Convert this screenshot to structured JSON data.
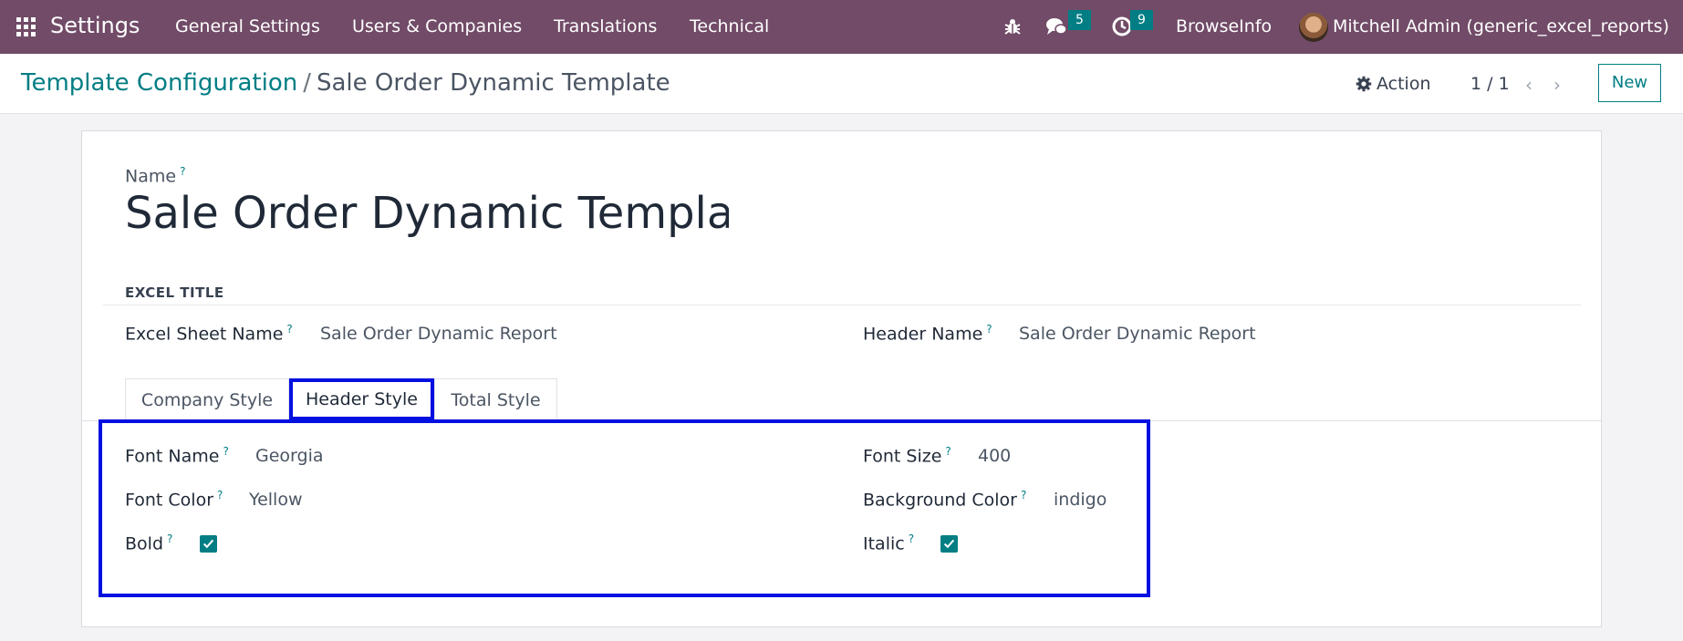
{
  "navbar": {
    "brand": "Settings",
    "menu": [
      "General Settings",
      "Users & Companies",
      "Translations",
      "Technical"
    ],
    "messages_badge": "5",
    "activities_badge": "9",
    "company": "BrowseInfo",
    "user": "Mitchell Admin (generic_excel_reports)"
  },
  "control": {
    "breadcrumb_parent": "Template Configuration",
    "breadcrumb_separator": "/",
    "breadcrumb_current": "Sale Order Dynamic Template",
    "action_label": "Action",
    "pager": "1 / 1",
    "new_label": "New"
  },
  "form": {
    "name_label": "Name",
    "name_value": "Sale Order Dynamic Template",
    "section_title": "EXCEL TITLE",
    "excel_sheet_name_label": "Excel Sheet Name",
    "excel_sheet_name_value": "Sale Order Dynamic Report",
    "header_name_label": "Header Name",
    "header_name_value": "Sale Order Dynamic Report",
    "help_mark": "?",
    "tabs": [
      "Company Style",
      "Header Style",
      "Total Style"
    ],
    "active_tab": "Header Style",
    "header_style": {
      "font_name_label": "Font Name",
      "font_name_value": "Georgia",
      "font_size_label": "Font Size",
      "font_size_value": "400",
      "font_color_label": "Font Color",
      "font_color_value": "Yellow",
      "background_color_label": "Background Color",
      "background_color_value": "indigo",
      "bold_label": "Bold",
      "bold_checked": true,
      "italic_label": "Italic",
      "italic_checked": true
    }
  },
  "colors": {
    "navbar": "#714b67",
    "accent": "#017e84",
    "highlight": "#0010e0"
  }
}
